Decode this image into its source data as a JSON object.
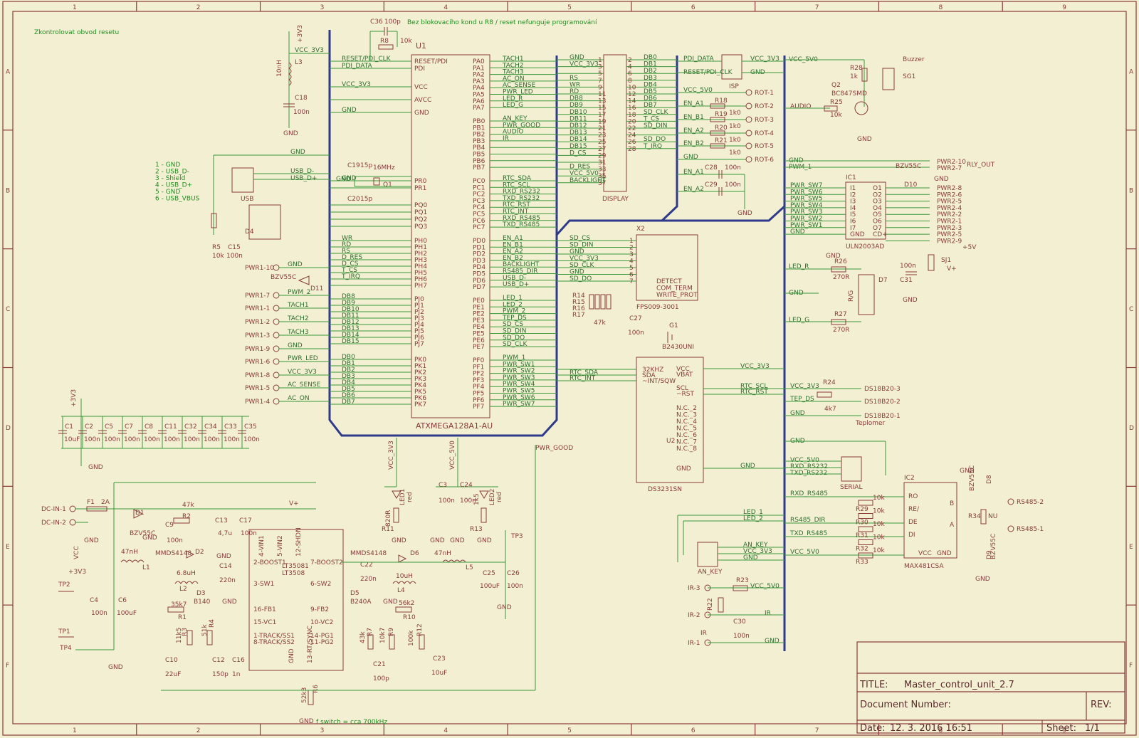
{
  "frame": {
    "columns": [
      "1",
      "2",
      "3",
      "4",
      "5",
      "6",
      "7",
      "8",
      "9"
    ],
    "rows": [
      "A",
      "B",
      "C",
      "D",
      "E",
      "F"
    ]
  },
  "notes": {
    "reset": "Zkontrolovat obvod resetu",
    "r8": "Bez blokovacího kond u R8 / reset nefunguje programování",
    "usb_pins": [
      "1 - GND",
      "2 - USB_D-",
      "3 - Shield",
      "4 - USB_D+",
      "5 - GND",
      "6 - USB_VBUS"
    ],
    "fswitch": "f switch = cca 700kHz"
  },
  "mcu": {
    "ref": "U1",
    "part": "ATXMEGA128A1-AU",
    "left_pins": [
      "RESET/PDI",
      "PDI",
      "VCC",
      "AVCC",
      "GND",
      "PR0",
      "PR1",
      "PQ0",
      "PQ1",
      "PQ2",
      "PQ3",
      "PH0",
      "PH1",
      "PH2",
      "PH3",
      "PH4",
      "PH5",
      "PH6",
      "PH7",
      "PJ0",
      "PJ1",
      "PJ2",
      "PJ3",
      "PJ4",
      "PJ5",
      "PJ6",
      "PJ7",
      "PK0",
      "PK1",
      "PK2",
      "PK3",
      "PK4",
      "PK5",
      "PK6",
      "PK7"
    ],
    "right_pins": [
      "PA0",
      "PA1",
      "PA2",
      "PA3",
      "PA4",
      "PA5",
      "PA6",
      "PA7",
      "PB0",
      "PB1",
      "PB2",
      "PB3",
      "PB4",
      "PB5",
      "PB6",
      "PB7",
      "PC0",
      "PC1",
      "PC2",
      "PC3",
      "PC4",
      "PC5",
      "PC6",
      "PC7",
      "PD0",
      "PD1",
      "PD2",
      "PD3",
      "PD4",
      "PD5",
      "PD6",
      "PD7",
      "PE0",
      "PE1",
      "PE2",
      "PE3",
      "PE4",
      "PE5",
      "PE6",
      "PE7",
      "PF0",
      "PF1",
      "PF2",
      "PF3",
      "PF4",
      "PF5",
      "PF6",
      "PF7"
    ]
  },
  "mcu_left_nets": [
    "RESET/PDI_CLK",
    "PDI_DATA",
    "VCC_3V3",
    "",
    "GND",
    "GND",
    "",
    "",
    "",
    "",
    "",
    "WR",
    "RD",
    "RS",
    "D_RES",
    "D_CS",
    "T_CS",
    "T_IRQ",
    "",
    "DB8",
    "DB9",
    "DB10",
    "DB11",
    "DB12",
    "DB13",
    "DB14",
    "DB15",
    "DB0",
    "DB1",
    "DB2",
    "DB3",
    "DB4",
    "DB5",
    "DB6",
    "DB7"
  ],
  "mcu_right_nets": [
    "TACH1",
    "TACH2",
    "TACH3",
    "AC_ON",
    "AC_SENSE",
    "PWR_LED",
    "LED_R",
    "LED_G",
    "AN_KEY",
    "PWR_GOOD",
    "AUDIO",
    "IR",
    "",
    "",
    "",
    "",
    "RTC_SDA",
    "RTC_SCL",
    "RXD_RS232",
    "TXD_RS232",
    "RTC_RST",
    "RTC_INT",
    "RXD_RS485",
    "TXD_RS485",
    "EN_A1",
    "EN_B1",
    "EN_A2",
    "EN_B2",
    "BACKLIGHT",
    "RS485_DIR",
    "USB_D-",
    "USB_D+",
    "LED_1",
    "LED_2",
    "PWM_2",
    "TEP_DS",
    "SD_CS",
    "SD_DIN",
    "SD_DO",
    "SD_CLK",
    "PWM_1",
    "PWR_SW1",
    "PWR_SW2",
    "PWR_SW3",
    "PWR_SW4",
    "PWR_SW5",
    "PWR_SW6",
    "PWR_SW7"
  ],
  "pwr1": {
    "ports": [
      "PWR1-10",
      "PWR1-7",
      "PWR1-1",
      "PWR1-2",
      "PWR1-3",
      "PWR1-9",
      "PWR1-6",
      "PWR1-8",
      "PWR1-5",
      "PWR1-4"
    ],
    "nets": [
      "GND",
      "PWM_2",
      "TACH1",
      "TACH2",
      "TACH3",
      "GND",
      "PWR_LED",
      "VCC_3V3",
      "AC_SENSE",
      "AC_ON"
    ]
  },
  "display": {
    "ref": "DISPLAY",
    "left_nets": [
      "GND",
      "VCC_3V3",
      "",
      "RS",
      "WR",
      "RD",
      "DB8",
      "DB9",
      "DB10",
      "DB11",
      "DB12",
      "DB13",
      "DB14",
      "DB15",
      "D_CS",
      "",
      "D_RES",
      "VCC_5V0",
      "BACKLIGHT"
    ],
    "right_nets": [
      "DB0",
      "DB1",
      "DB2",
      "DB3",
      "DB4",
      "DB5",
      "DB6",
      "DB7",
      "SD_CLK",
      "T_CS",
      "SD_DIN",
      "",
      "SD_DO",
      "T_IRQ"
    ]
  },
  "isp": {
    "ref": "ISP",
    "nets_left": [
      "PDI_DATA",
      "RESET/PDI_CLK"
    ],
    "nets_right": [
      "VCC_3V3",
      "GND"
    ]
  },
  "rot": {
    "nets": [
      "VCC_5V0",
      "EN_A1",
      "EN_B1",
      "EN_A2",
      "EN_B2",
      "GND"
    ],
    "resistors": [
      "R18",
      "R19",
      "R20",
      "R21"
    ],
    "value": "1k0",
    "ports": [
      "ROT-1",
      "ROT-2",
      "ROT-3",
      "ROT-4",
      "ROT-5",
      "ROT-6"
    ],
    "caps": [
      "C28",
      "C29"
    ],
    "cap_value": "100n",
    "cap_nets": [
      "EN_A1",
      "EN_A2"
    ]
  },
  "sdcard": {
    "ref": "X2",
    "part": "FPS009-3001",
    "nets": [
      "SD_CS",
      "SD_DIN",
      "GND",
      "VCC_3V3",
      "SD_CLK",
      "GND",
      "SD_DO"
    ],
    "extra": [
      "DETECT",
      "COM_TERM",
      "WRITE_PROT"
    ],
    "resistors": [
      "R14",
      "R15",
      "R16",
      "R17"
    ],
    "rvalue": "47k",
    "cap": "C27",
    "cap_value": "100n"
  },
  "rtc": {
    "ref": "U2",
    "part": "DS3231SN",
    "left": [
      "32KHZ",
      "SDA",
      "~INT/SQW"
    ],
    "left_nets": [
      "",
      "RTC_SDA",
      "RTC_INT"
    ],
    "right": [
      "VCC",
      "VBAT",
      "SCL",
      "~RST",
      "N.C._2",
      "N.C._3",
      "N.C._4",
      "N.C._5",
      "N.C._6",
      "N.C._7",
      "N.C._8",
      "GND"
    ],
    "right_nets": [
      "VCC_3V3",
      "",
      "RTC_SCL",
      "RTC_RST",
      "GND"
    ],
    "battery": "G1",
    "battery_part": "B2430UNI"
  },
  "buzzer": {
    "net_in": "AUDIO",
    "r_base": "R25",
    "r_base_val": "10k",
    "q": "Q2",
    "q_part": "BC847SMD",
    "r_top": "R28",
    "r_top_val": "1k",
    "ref": "SG1",
    "label": "Buzzer",
    "vcc": "VCC_5V0"
  },
  "uln": {
    "ref": "IC1",
    "part": "ULN2003AD",
    "in_nets": [
      "PWR_SW7",
      "PWR_SW6",
      "PWR_SW5",
      "PWR_SW4",
      "PWR_SW3",
      "PWR_SW2",
      "PWR_SW1",
      "GND"
    ],
    "in_pins": [
      "I1",
      "I2",
      "I3",
      "I4",
      "I5",
      "I6",
      "I7",
      "GND"
    ],
    "out_pins": [
      "O1",
      "O2",
      "O3",
      "O4",
      "O5",
      "O6",
      "O7",
      "CD+"
    ],
    "out_ports": [
      "PWR2-8",
      "PWR2-6",
      "PWR2-5",
      "PWR2-4",
      "PWR2-2",
      "PWR2-1",
      "PWR2-3",
      "PWR2-5",
      "PWR2-9"
    ],
    "top_ports": [
      "PWR2-10",
      "PWR2-7"
    ],
    "top_nets": [
      "GND",
      "PWM_1"
    ],
    "rly": "RLY_OUT",
    "zener": "D10",
    "zener_part": "BZV55C"
  },
  "supply5v": {
    "ref": "SJ1",
    "net": "+5V",
    "vplus": "V+",
    "cap": "C31",
    "cap_value": "100n"
  },
  "rgled": {
    "ref": "D7",
    "label": "R/G",
    "r1": "R26",
    "r2": "R27",
    "rval": "270R",
    "nets": [
      "LED_R",
      "GND",
      "LED_G"
    ]
  },
  "temp": {
    "nets": [
      "VCC_3V3",
      "TEP_DS",
      "GND"
    ],
    "r": "R24",
    "rval": "4k7",
    "ports": [
      "DS18B20-3",
      "DS18B20-2",
      "DS18B20-1"
    ],
    "label": "Teplomer"
  },
  "serial": {
    "ref": "SERIAL",
    "nets": [
      "GND",
      "VCC_5V0",
      "RXD_RS232",
      "TXD_RS232"
    ]
  },
  "rs485": {
    "ref": "IC2",
    "part": "MAX481CSA",
    "nets": [
      "RXD_RS485",
      "RS485_DIR",
      "TXD_RS485",
      "VCC_5V0"
    ],
    "resistors": [
      "R29",
      "R30",
      "R31",
      "R32",
      "R33"
    ],
    "rval": "10k",
    "pins_left": [
      "RO",
      "RE/",
      "DE",
      "DI"
    ],
    "pins_right": [
      "B",
      "A"
    ],
    "bottom": [
      "VCC",
      "GND"
    ],
    "r_term": "R34",
    "r_term_val": "NU",
    "ports": [
      "RS485-2",
      "RS485-1"
    ],
    "diodes": [
      "D8",
      "D9"
    ],
    "diode_part": "BZV55C"
  },
  "ankey": {
    "ref": "AN_KEY",
    "nets": [
      "LED_1",
      "LED_2",
      "AN_KEY",
      "VCC_3V3",
      "GND"
    ]
  },
  "ir": {
    "ports": [
      "IR-3",
      "IR-2",
      "IR-1"
    ],
    "nets": [
      "VCC_5V0",
      "IR",
      "GND"
    ],
    "r": "R23",
    "r2": "R22",
    "cap": "C30",
    "cap_value": "100n",
    "net_ir": "IR"
  },
  "usb": {
    "ref": "USB",
    "nets": [
      "GND",
      "USB_D-",
      "USB_D+",
      "GND"
    ],
    "r": "R5",
    "rval": "10k",
    "cap": "C15",
    "cval": "100n",
    "diode": "D4"
  },
  "topleft": {
    "vcc": "+3V3",
    "l": "L3",
    "lval": "10nH",
    "c": "C18",
    "cval": "100n",
    "net": "VCC_3V3",
    "gnd": "GND"
  },
  "reset": {
    "c": "C36",
    "cval": "100p",
    "r": "R8",
    "rval": "10k"
  },
  "crystal": {
    "c1": "C19",
    "c2": "C20",
    "cval": "15p",
    "q": "Q1",
    "freq": "16MHz"
  },
  "decoupling": {
    "vcc": "+3V3",
    "caps": [
      "C1",
      "C2",
      "C5",
      "C7",
      "C8",
      "C11",
      "C32",
      "C34",
      "C33",
      "C35"
    ],
    "vals": [
      "10uF",
      "100n",
      "100n",
      "100n",
      "100n",
      "100n",
      "100n",
      "100n",
      "100n",
      "100n"
    ],
    "gnd": "GND"
  },
  "psu": {
    "ic": "LT35081",
    "ic2": "LT3508",
    "inputs": [
      "DC-IN-1",
      "DC-IN-2"
    ],
    "fuse": "F1",
    "fuse_val": "2A",
    "d1": "D1",
    "d1_part": "BZV55C",
    "r2": "R2",
    "r2_val": "47k",
    "d2": "D2",
    "d2_part": "MMDS4148",
    "c9": "C9",
    "c9_val": "100n",
    "c13": "C13",
    "c13_val": "4,7u",
    "c17": "C17",
    "c17_val": "100n",
    "l1": "L1",
    "l1_val": "47nH",
    "l2": "L2",
    "l2_val": "6.8uH",
    "d3": "D3",
    "d3_part": "B140",
    "c14": "C14",
    "c14_val": "220n",
    "pins_left": [
      "2-BOOST1",
      "3-SW1",
      "16-FB1",
      "15-VC1",
      "1-TRACK/SS1",
      "8-TRACK/SS2"
    ],
    "pins_right": [
      "7-BOOST2",
      "6-SW2",
      "9-FB2",
      "10-VC2",
      "14-PG1",
      "11-PG2"
    ],
    "pins_top": [
      "4-VIN1",
      "5-VIN2",
      "12-SHDN"
    ],
    "pins_bottom": [
      "GND",
      "13-RT/SYNC"
    ],
    "r1": "R1",
    "r1_val": "35k7",
    "r3": "R3",
    "r3_val": "11k5",
    "r4": "R4",
    "r4_val": "51k",
    "c10": "C10",
    "c10_val": "22uF",
    "c12": "C12",
    "c12_val": "150p",
    "c16": "C16",
    "c16_val": "1n",
    "r6": "R6",
    "r6_val": "52k3",
    "d6": "D6",
    "d6_part": "MMDS4148",
    "c22": "C22",
    "c22_val": "220n",
    "l4": "L4",
    "l4_val": "10uH",
    "d5": "D5",
    "d5_part": "B240A",
    "r10": "R10",
    "r10_val": "56k2",
    "l5": "L5",
    "l5_val": "47nH",
    "c25": "C25",
    "c25_val": "100uF",
    "c26": "C26",
    "c26_val": "100n",
    "r7": "R7",
    "r7_val": "43k",
    "r9": "R9",
    "r9_val": "10k7",
    "r12": "R12",
    "r12_val": "100k",
    "c21": "C21",
    "c21_val": "100p",
    "c23": "C23",
    "c23_val": "10uF",
    "c4": "C4",
    "c4_val": "100n",
    "c6": "C6",
    "c6_val": "100uF",
    "tp": [
      "TP2",
      "TP1",
      "TP4",
      "TP3"
    ],
    "vcc": "VCC",
    "v3": "+3V3",
    "vplus": "V+",
    "gnd": "GND",
    "pwr_good": "PWR_GOOD"
  },
  "leds": {
    "vcc3": "VCC_3V3",
    "vcc5": "VCC_5V0",
    "led1": "LED1",
    "led1_col": "red",
    "r11": "R11",
    "r11_val": "820R",
    "led2": "LED2",
    "led2_col": "red",
    "r13": "R13",
    "r13_val": "1k5",
    "c3": "C3",
    "c3_val": "100n",
    "c24": "C24",
    "c24_val": "100n"
  },
  "title_block": {
    "title_label": "TITLE:",
    "title": "Master_control_unit_2.7",
    "docnum_label": "Document Number:",
    "rev_label": "REV:",
    "date_label": "Date:",
    "date": "12. 3. 2016 16:51",
    "sheet_label": "Sheet:",
    "sheet": "1/1"
  },
  "colors": {
    "background": "#f2efd2",
    "component": "#8a3b3b",
    "wire": "#3a9a3a",
    "bus": "#2f3a8a",
    "note": "#1e8f1e"
  }
}
